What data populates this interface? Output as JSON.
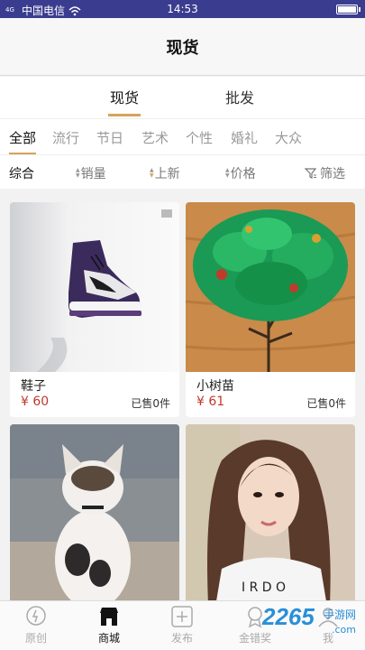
{
  "status_bar": {
    "signal": "4G",
    "carrier": "中国电信",
    "time": "14:53"
  },
  "header": {
    "title": "现货"
  },
  "mode_tabs": [
    {
      "label": "现货"
    },
    {
      "label": "批发"
    }
  ],
  "categories": [
    "全部",
    "流行",
    "节日",
    "艺术",
    "个性",
    "婚礼",
    "大众"
  ],
  "sort": {
    "comprehensive": "综合",
    "sales": "销量",
    "newest": "上新",
    "price": "价格",
    "filter": "筛选"
  },
  "products": [
    {
      "name": "鞋子",
      "price": "¥ 60",
      "sold": "已售0件"
    },
    {
      "name": "小树苗",
      "price": "¥ 61",
      "sold": "已售0件"
    }
  ],
  "tabbar": [
    {
      "label": "原创"
    },
    {
      "label": "商城"
    },
    {
      "label": "发布"
    },
    {
      "label": "金错奖"
    },
    {
      "label": "我"
    }
  ],
  "watermark": {
    "number": "2265",
    "suffix": ".com",
    "text": "手游网"
  },
  "colors": {
    "accent": "#d4a55a",
    "price": "#c0392b",
    "status_bar": "#3a3d8f"
  }
}
